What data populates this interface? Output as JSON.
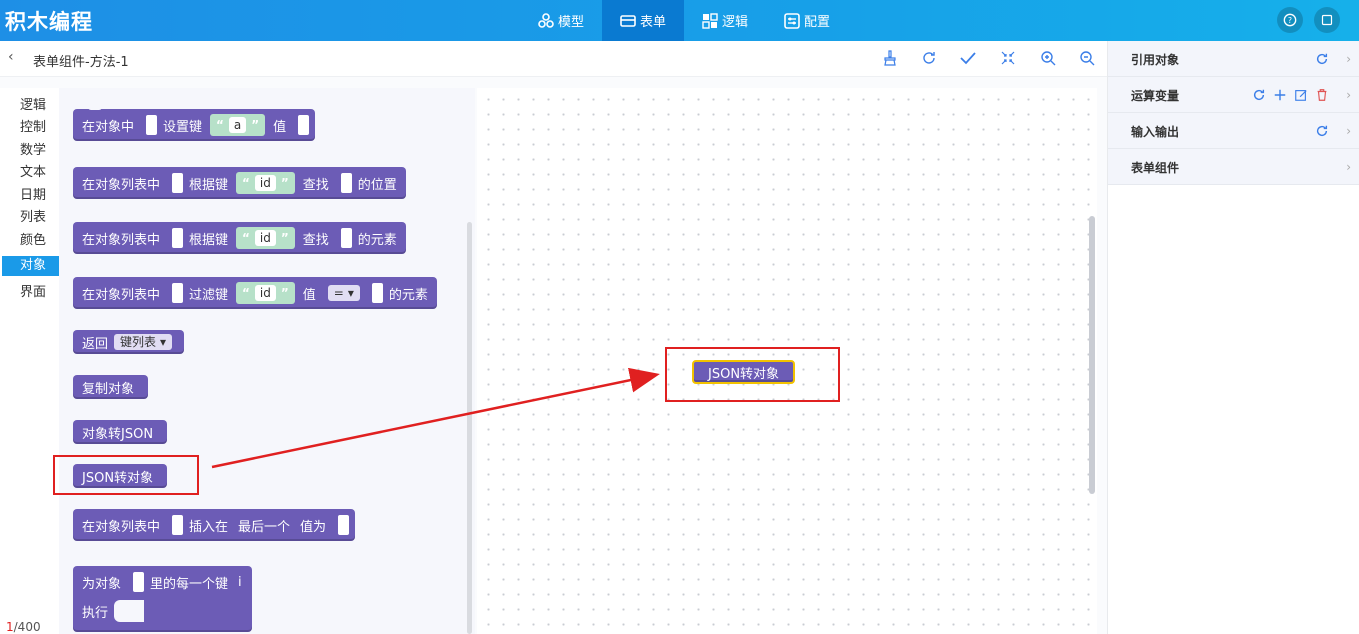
{
  "app": {
    "title": "积木编程"
  },
  "nav": {
    "items": [
      {
        "label": "模型",
        "icon": "model-icon"
      },
      {
        "label": "表单",
        "icon": "form-icon",
        "active": true
      },
      {
        "label": "逻辑",
        "icon": "logic-icon"
      },
      {
        "label": "配置",
        "icon": "config-icon"
      }
    ]
  },
  "toolbar": {
    "back": "‹",
    "breadcrumb": "表单组件-方法-1",
    "icons": [
      "clean-icon",
      "refresh-icon",
      "check-icon",
      "collapse-icon",
      "zoom-in-icon",
      "zoom-out-icon"
    ]
  },
  "right_panel": {
    "sections": [
      {
        "label": "引用对象"
      },
      {
        "label": "运算变量"
      },
      {
        "label": "输入输出"
      },
      {
        "label": "表单组件"
      }
    ]
  },
  "categories": [
    "逻辑",
    "控制",
    "数学",
    "文本",
    "日期",
    "列表",
    "颜色",
    "对象",
    "界面"
  ],
  "active_category": "对象",
  "blocks": {
    "b1": {
      "t1": "在对象中",
      "t2": "设置键",
      "key": "a",
      "t3": "值"
    },
    "b2": {
      "t1": "在对象列表中",
      "t2": "根据键",
      "key": "id",
      "t3": "查找",
      "t4": "的位置"
    },
    "b3": {
      "t1": "在对象列表中",
      "t2": "根据键",
      "key": "id",
      "t3": "查找",
      "t4": "的元素"
    },
    "b4": {
      "t1": "在对象列表中",
      "t2": "过滤键",
      "key": "id",
      "t3": "值",
      "op": "=",
      "t4": "的元素"
    },
    "b5": {
      "t1": "返回",
      "dd": "键列表"
    },
    "b6": {
      "t1": "复制对象"
    },
    "b7": {
      "t1": "对象转JSON"
    },
    "b8": {
      "t1": "JSON转对象"
    },
    "b9": {
      "t1": "在对象列表中",
      "t2": "插入在",
      "t3": "最后一个",
      "t4": "值为"
    },
    "b10": {
      "t1": "为对象",
      "t2": "里的每一个键",
      "t3": "i",
      "t4": "执行"
    }
  },
  "quote_open": "“",
  "quote_close": "”",
  "canvas_block": {
    "label": "JSON转对象"
  },
  "counter": {
    "current": "1",
    "total": "/400"
  },
  "colors": {
    "accent": "#1a9ae8",
    "block": "#6c5cb6",
    "string": "#b7e1c9",
    "highlight": "#e02020"
  }
}
